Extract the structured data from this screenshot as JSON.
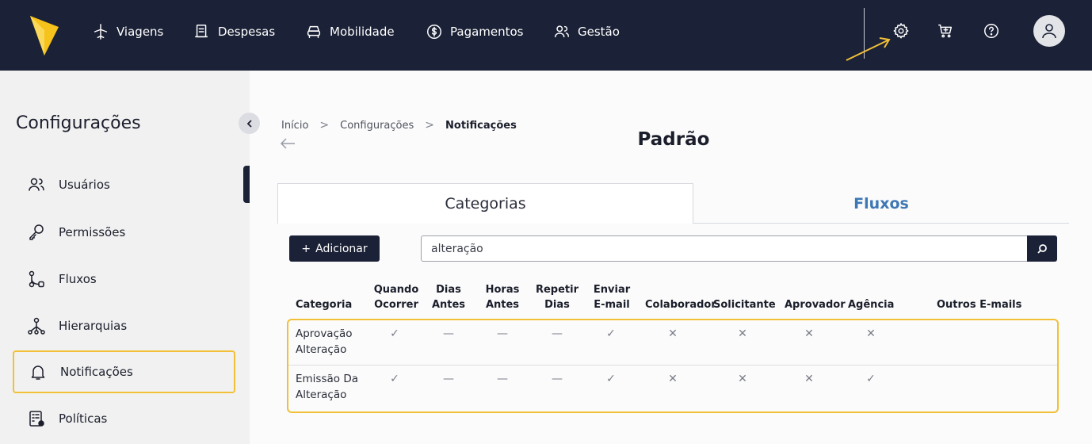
{
  "nav": {
    "items": [
      {
        "label": "Viagens",
        "icon": "plane-icon"
      },
      {
        "label": "Despesas",
        "icon": "receipt-icon"
      },
      {
        "label": "Mobilidade",
        "icon": "car-icon"
      },
      {
        "label": "Pagamentos",
        "icon": "dollar-circle-icon"
      },
      {
        "label": "Gestão",
        "icon": "users-icon"
      }
    ],
    "right_icons": [
      "gear-icon",
      "cart-icon",
      "help-icon",
      "avatar-icon"
    ],
    "brand_color": "#1b2136",
    "logo_color": "#f6c21c"
  },
  "sidebar": {
    "title": "Configurações",
    "items": [
      {
        "label": "Usuários",
        "icon": "users-icon"
      },
      {
        "label": "Permissões",
        "icon": "key-icon"
      },
      {
        "label": "Fluxos",
        "icon": "flow-icon"
      },
      {
        "label": "Hierarquias",
        "icon": "hierarchy-icon"
      },
      {
        "label": "Notificações",
        "icon": "bell-icon"
      },
      {
        "label": "Políticas",
        "icon": "policy-icon"
      }
    ]
  },
  "breadcrumb": {
    "items": [
      "Início",
      "Configurações",
      "Notificações"
    ],
    "separator": ">"
  },
  "page": {
    "title": "Padrão"
  },
  "tabs": {
    "categorias": "Categorias",
    "fluxos": "Fluxos"
  },
  "toolbar": {
    "add_label": "Adicionar",
    "add_symbol": "+",
    "search_value": "alteração"
  },
  "table": {
    "headers": {
      "categoria": "Categoria",
      "quando1": "Quando",
      "quando2": "Ocorrer",
      "dias1": "Dias",
      "dias2": "Antes",
      "horas1": "Horas",
      "horas2": "Antes",
      "repetir1": "Repetir",
      "repetir2": "Dias",
      "enviar1": "Enviar",
      "enviar2": "E-mail",
      "colaborador": "Colaborador",
      "solicitante": "Solicitante",
      "aprovador": "Aprovador",
      "agencia": "Agência",
      "outros": "Outros E-mails"
    },
    "rows": [
      {
        "categoria_l1": "Aprovação",
        "categoria_l2": "Alteração",
        "quando": "✓",
        "dias": "—",
        "horas": "—",
        "repetir": "—",
        "enviar": "✓",
        "colaborador": "✕",
        "solicitante": "✕",
        "aprovador": "✕",
        "agencia": "✕",
        "outros": ""
      },
      {
        "categoria_l1": "Emissão Da",
        "categoria_l2": "Alteração",
        "quando": "✓",
        "dias": "—",
        "horas": "—",
        "repetir": "—",
        "enviar": "✓",
        "colaborador": "✕",
        "solicitante": "✕",
        "aprovador": "✕",
        "agencia": "✓",
        "outros": ""
      }
    ]
  },
  "highlight_color": "#f2c037",
  "tab_accent_color": "#3d78b5"
}
